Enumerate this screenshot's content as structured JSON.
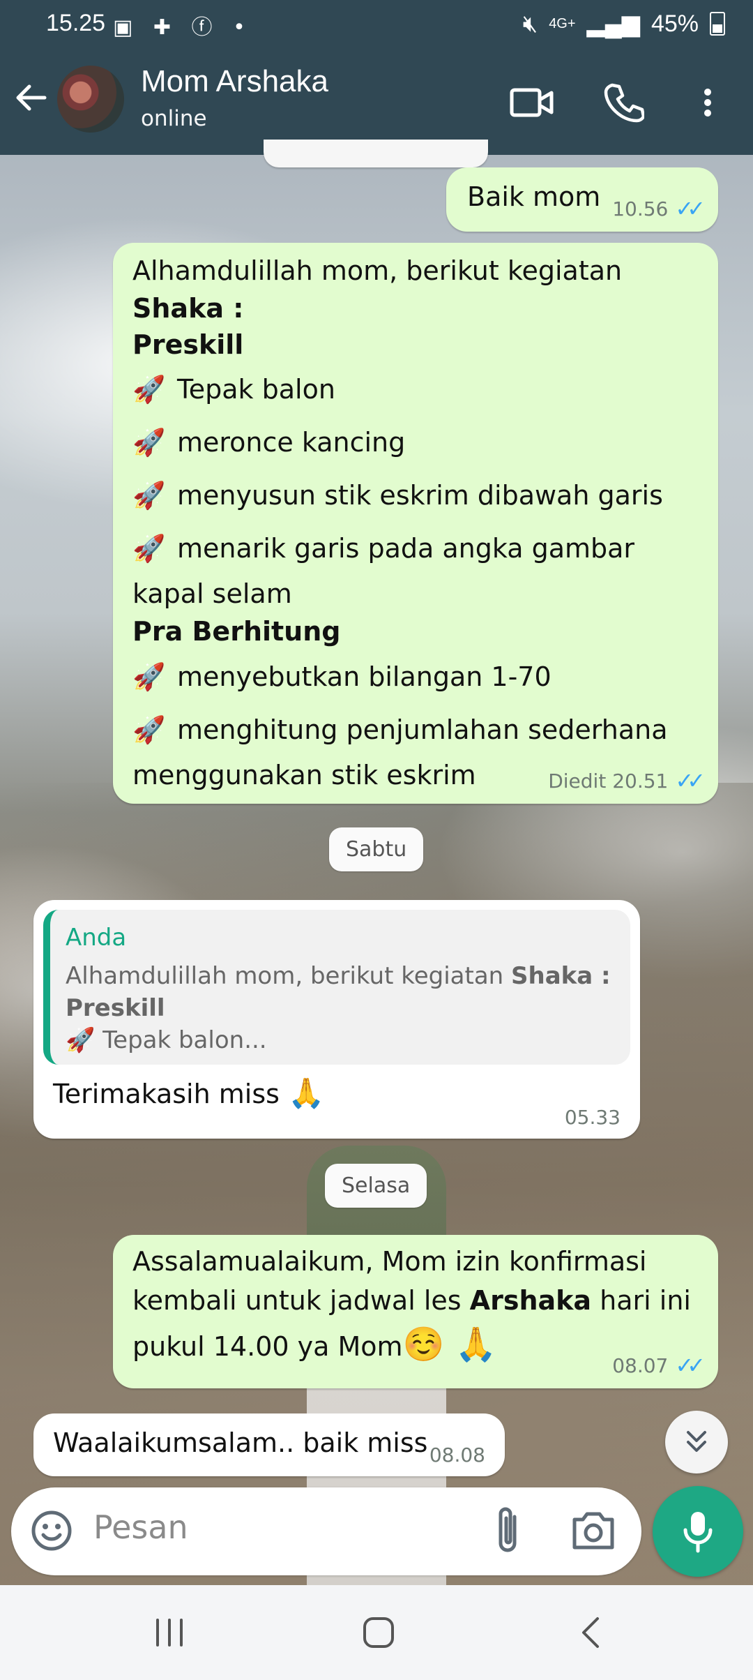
{
  "status_bar": {
    "time": "15.25",
    "network": "4G+",
    "battery": "45%"
  },
  "header": {
    "contact_name": "Mom Arshaka",
    "status": "online"
  },
  "messages": {
    "m1": {
      "text": "Baik mom",
      "time": "10.56"
    },
    "m2": {
      "l1": "Alhamdulillah mom, berikut kegiatan",
      "l2": "Shaka :",
      "l3": "Preskill",
      "l4": "Tepak balon",
      "l5": "meronce kancing",
      "l6": "menyusun stik eskrim dibawah garis",
      "l7": "menarik garis pada angka gambar",
      "l8": "kapal selam",
      "l9": "Pra Berhitung",
      "l10": "menyebutkan bilangan 1-70",
      "l11": "menghitung penjumlahan sederhana",
      "l12": "menggunakan stik eskrim",
      "time": "Diedit 20.51"
    },
    "date1": "Sabtu",
    "m3": {
      "quote_sender": "Anda",
      "quote_l1a": "Alhamdulillah mom, berikut kegiatan ",
      "quote_l1b": "Shaka :",
      "quote_l2": "Preskill",
      "quote_l3": "Tepak balon...",
      "text": "Terimakasih miss",
      "time": "05.33"
    },
    "date2": "Selasa",
    "m4": {
      "l1": "Assalamualaikum, Mom izin konfirmasi",
      "l2a": "kembali untuk jadwal les ",
      "l2b": "Arshaka",
      "l2c": " hari ini",
      "l3": "pukul 14.00 ya Mom",
      "time": "08.07"
    },
    "m5": {
      "text": "Waalaikumsalam.. baik miss",
      "time": "08.08"
    }
  },
  "input": {
    "placeholder": "Pesan"
  },
  "colors": {
    "header": "#304854",
    "outgoing_bubble": "#e2fccf",
    "incoming_bubble": "#ffffff",
    "accent": "#1ea884",
    "read_ticks": "#39a4f4"
  }
}
